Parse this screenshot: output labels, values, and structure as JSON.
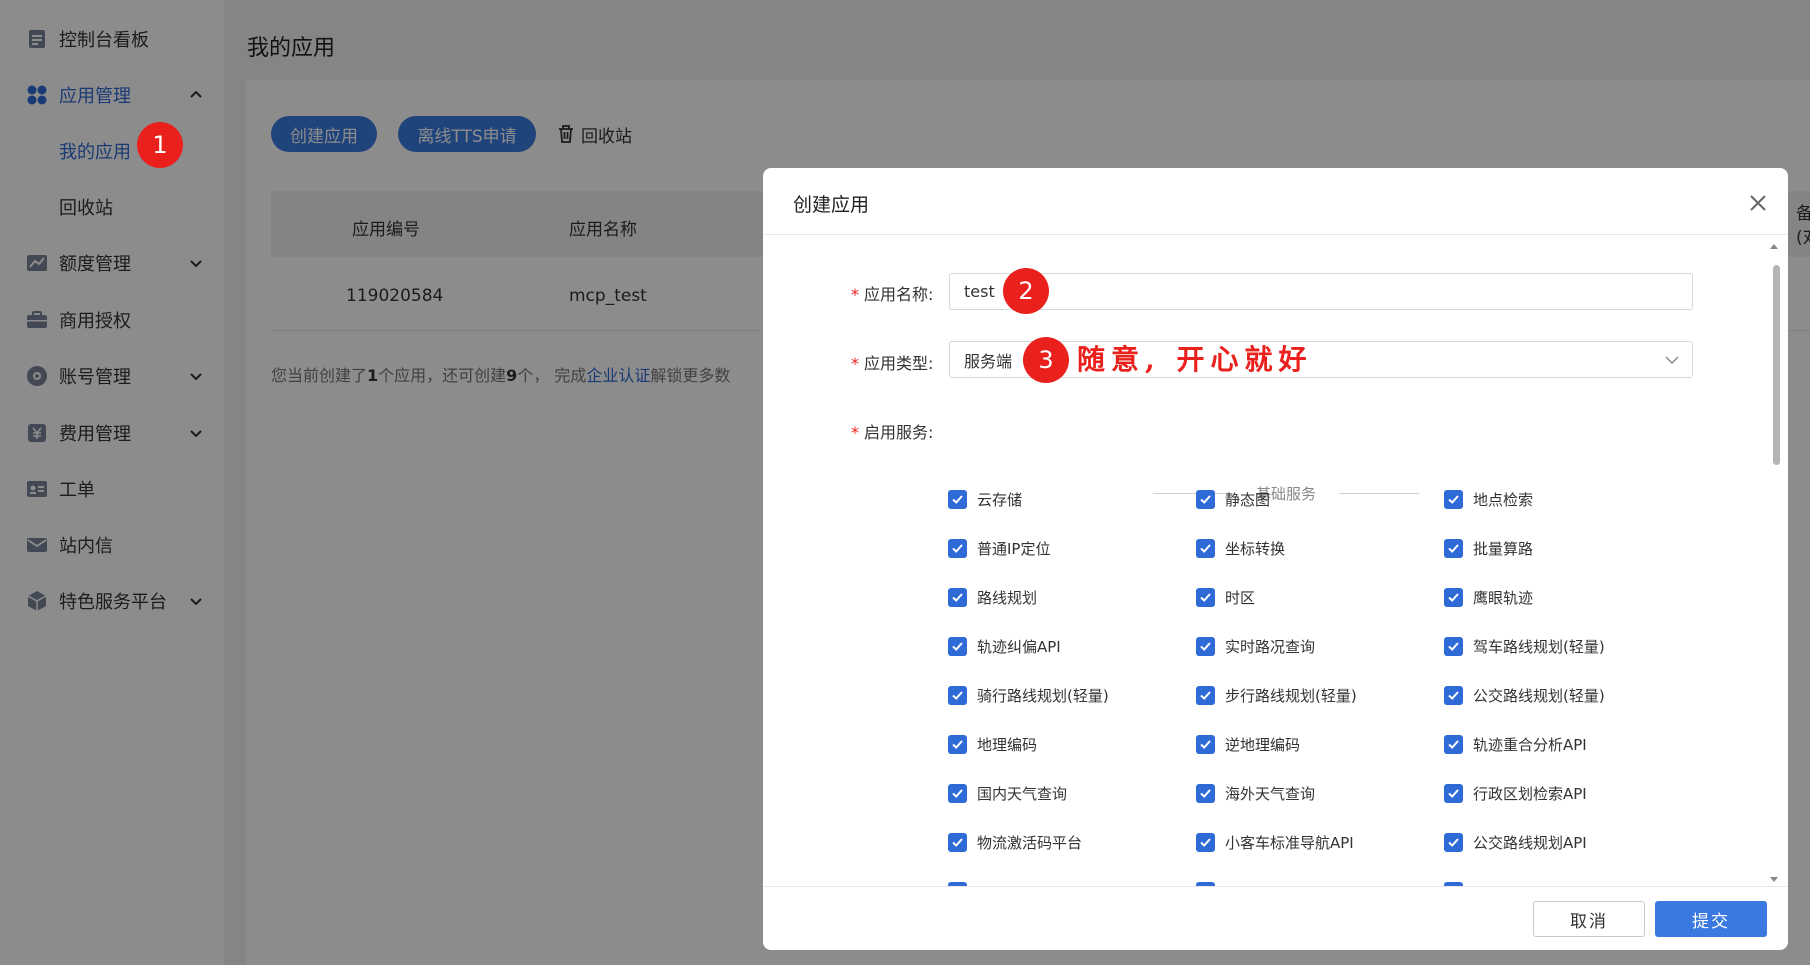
{
  "sidebar": {
    "items": [
      {
        "label": "控制台看板",
        "icon": "document-icon",
        "active": false
      },
      {
        "label": "应用管理",
        "icon": "grid-icon",
        "active": true,
        "expanded": true
      },
      {
        "label": "我的应用",
        "sub": true,
        "active": true
      },
      {
        "label": "回收站",
        "sub": true,
        "active": false
      },
      {
        "label": "额度管理",
        "icon": "chart-icon",
        "active": false
      },
      {
        "label": "商用授权",
        "icon": "briefcase-icon",
        "active": false
      },
      {
        "label": "账号管理",
        "icon": "account-icon",
        "active": false
      },
      {
        "label": "费用管理",
        "icon": "money-icon",
        "active": false
      },
      {
        "label": "工单",
        "icon": "id-card-icon",
        "active": false
      },
      {
        "label": "站内信",
        "icon": "mail-icon",
        "active": false
      },
      {
        "label": "特色服务平台",
        "icon": "cube-icon",
        "active": false
      }
    ]
  },
  "content": {
    "title": "我的应用",
    "create_btn": "创建应用",
    "tts_btn": "离线TTS申请",
    "recycle_link": "回收站",
    "table": {
      "headers": [
        "应用编号",
        "应用名称"
      ],
      "rows": [
        [
          "119020584",
          "mcp_test"
        ]
      ],
      "cut_header": [
        "备",
        "(对"
      ]
    },
    "notice": {
      "part1": "您当前创建了",
      "count": "1",
      "part2": "个应用，还可创建",
      "remain": "9",
      "part3": "个， 完成",
      "link": "企业认证",
      "part4": "解锁更多数"
    }
  },
  "badges": [
    "1",
    "2",
    "3"
  ],
  "modal": {
    "title": "创建应用",
    "name_label": "应用名称:",
    "name_value": "test",
    "annotation": "随意, 开心就好",
    "type_label": "应用类型:",
    "type_value": "服务端",
    "services_label": "启用服务:",
    "section_title": "基础服务",
    "services": [
      "云存储",
      "静态图",
      "地点检索",
      "普通IP定位",
      "坐标转换",
      "批量算路",
      "路线规划",
      "时区",
      "鹰眼轨迹",
      "轨迹纠偏API",
      "实时路况查询",
      "驾车路线规划(轻量)",
      "骑行路线规划(轻量)",
      "步行路线规划(轻量)",
      "公交路线规划(轻量)",
      "地理编码",
      "逆地理编码",
      "轨迹重合分析API",
      "国内天气查询",
      "海外天气查询",
      "行政区划检索API",
      "物流激活码平台",
      "小客车标准导航API",
      "公交路线规划API"
    ],
    "cancel_btn": "取消",
    "submit_btn": "提交"
  },
  "colors": {
    "primary": "#3a7ae0",
    "active_text": "#2f6bd6",
    "badge_red": "#e9201c",
    "overlay": "rgba(0,0,0,0.45)"
  }
}
